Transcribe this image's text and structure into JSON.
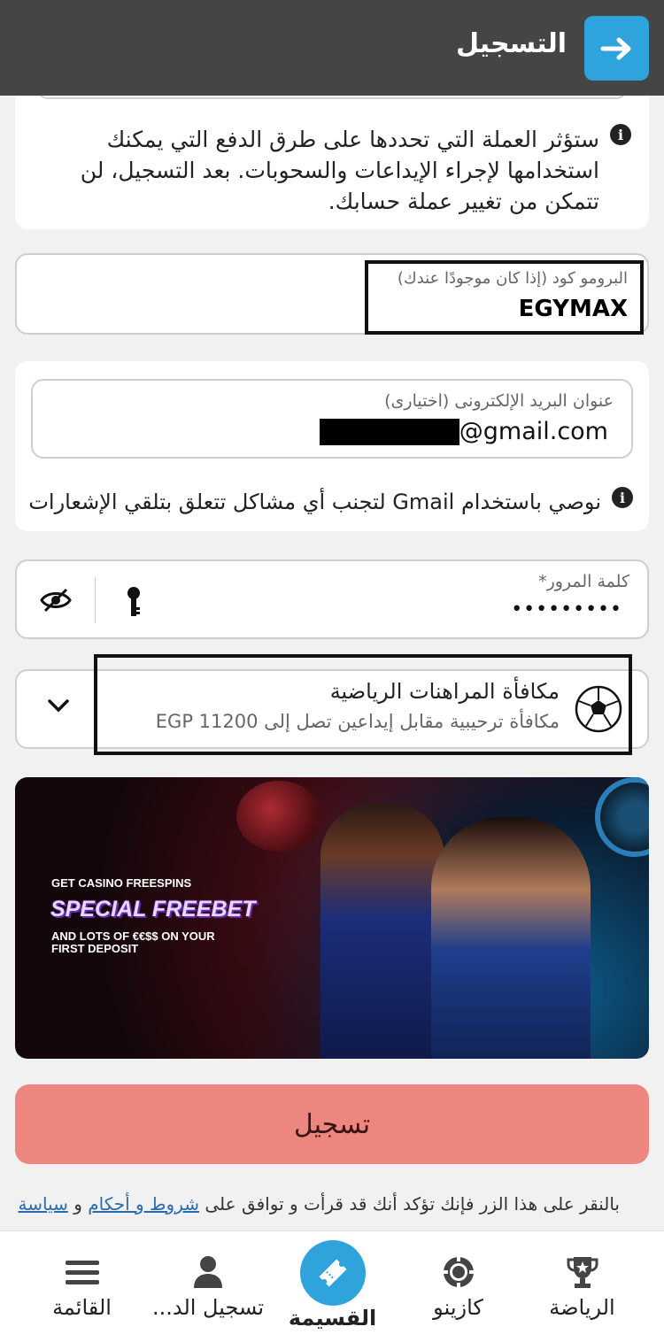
{
  "header": {
    "title": "التسجيل",
    "back_icon": "arrow-right-icon",
    "accent_color": "#2ea3dc"
  },
  "currency_note": {
    "text": "ستؤثر العملة التي تحددها على طرق الدفع التي يمكنك استخدامها لإجراء الإيداعات والسحوبات. بعد التسجيل، لن تتمكن من تغيير عملة حسابك."
  },
  "promo": {
    "label": "البرومو كود (إذا كان موجودًا عندك)",
    "value": "EGYMAX"
  },
  "email": {
    "label": "عنوان البريد الإلكترونى (اختيارى)",
    "value": "@gmail.com",
    "note": "نوصي باستخدام Gmail لتجنب أي مشاكل تتعلق بتلقي الإشعارات"
  },
  "password": {
    "label": "كلمة المرور*",
    "value": "•••••••••"
  },
  "bonus": {
    "title": "مكافأة المراهنات الرياضية",
    "subtitle": "مكافأة ترحيبية مقابل إيداعين تصل إلى EGP 11200"
  },
  "banner": {
    "line1": "GET CASINO FREESPINS",
    "line2": "SPECIAL FREEBET",
    "line3": "AND LOTS OF €€$$ ON YOUR",
    "line4": "FIRST DEPOSIT"
  },
  "submit": {
    "label": "تسجيل",
    "color": "#ee8680"
  },
  "terms": {
    "prefix": "بالنقر على هذا الزر فإنك تؤكد أنك قد قرأت و توافق على ",
    "link1": "شروط و أحكام",
    "middle": " و ",
    "link2": "سياسة"
  },
  "bottom_nav": {
    "items": [
      {
        "label": "الرياضة",
        "icon": "trophy-icon"
      },
      {
        "label": "كازينو",
        "icon": "casino-chip-icon"
      },
      {
        "label": "القسيمة",
        "icon": "ticket-icon"
      },
      {
        "label": "تسجيل الد...",
        "icon": "user-icon"
      },
      {
        "label": "القائمة",
        "icon": "hamburger-menu-icon"
      }
    ]
  }
}
